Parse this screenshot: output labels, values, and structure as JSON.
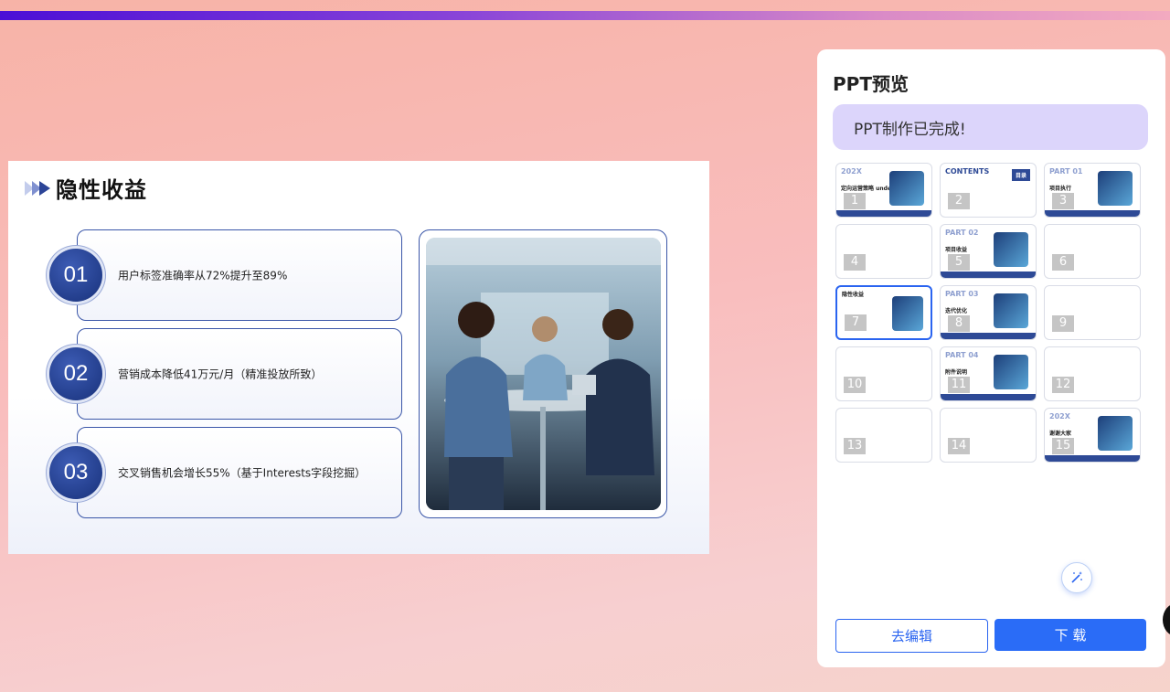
{
  "slide": {
    "title": "隐性收益",
    "items": [
      {
        "num": "01",
        "text": "用户标签准确率从72%提升至89%"
      },
      {
        "num": "02",
        "text": "营销成本降低41万元/月（精准投放所致）"
      },
      {
        "num": "03",
        "text": "交叉销售机会增长55%（基于Interests字段挖掘）"
      }
    ]
  },
  "panel": {
    "title": "PPT预览",
    "status": "PPT制作已完成!",
    "thumbnails": [
      {
        "num": "1",
        "header": "202X",
        "title": "定向运营策略 undefined"
      },
      {
        "num": "2",
        "header": "CONTENTS",
        "title": "目录"
      },
      {
        "num": "3",
        "header": "PART 01",
        "title": "项目执行"
      },
      {
        "num": "4",
        "header": "",
        "title": ""
      },
      {
        "num": "5",
        "header": "PART 02",
        "title": "项目收益"
      },
      {
        "num": "6",
        "header": "",
        "title": ""
      },
      {
        "num": "7",
        "header": "",
        "title": "隐性收益"
      },
      {
        "num": "8",
        "header": "PART 03",
        "title": "迭代优化"
      },
      {
        "num": "9",
        "header": "",
        "title": ""
      },
      {
        "num": "10",
        "header": "",
        "title": ""
      },
      {
        "num": "11",
        "header": "PART 04",
        "title": "附件说明"
      },
      {
        "num": "12",
        "header": "",
        "title": ""
      },
      {
        "num": "13",
        "header": "",
        "title": ""
      },
      {
        "num": "14",
        "header": "",
        "title": ""
      },
      {
        "num": "15",
        "header": "202X",
        "title": "谢谢大家"
      }
    ],
    "edit_label": "去编辑",
    "download_label": "下 载"
  }
}
